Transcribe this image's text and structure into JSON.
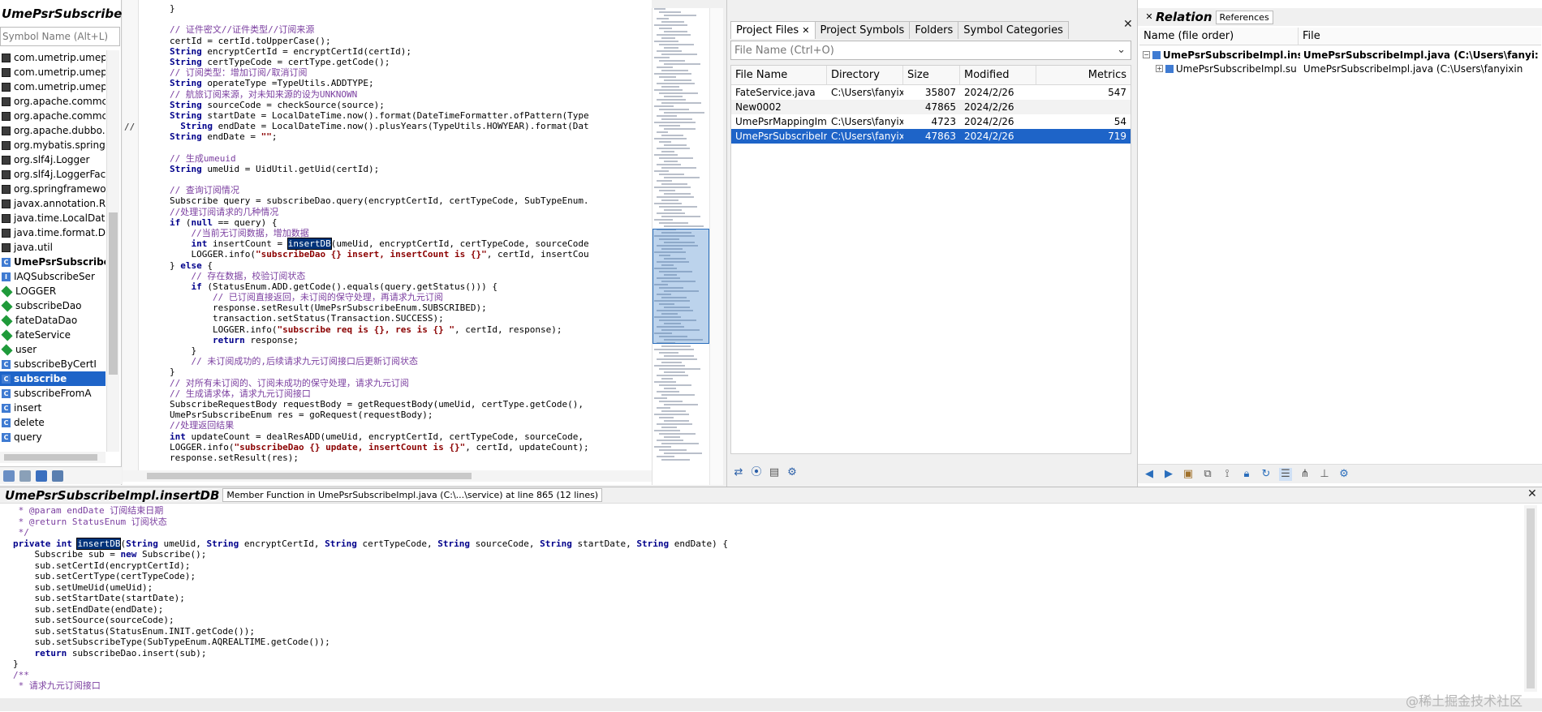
{
  "left_panel": {
    "title": "UmePsrSubscribeImpl",
    "search_placeholder": "Symbol Name (Alt+L)",
    "items": [
      {
        "label": "com.umetrip.umeps",
        "icon": "block-icon",
        "style": ""
      },
      {
        "label": "com.umetrip.umeps",
        "icon": "block-icon",
        "style": ""
      },
      {
        "label": "com.umetrip.umeps",
        "icon": "block-icon",
        "style": ""
      },
      {
        "label": "org.apache.commc",
        "icon": "block-icon",
        "style": ""
      },
      {
        "label": "org.apache.commc",
        "icon": "block-icon",
        "style": ""
      },
      {
        "label": "org.apache.dubbo.",
        "icon": "block-icon",
        "style": ""
      },
      {
        "label": "org.mybatis.spring.",
        "icon": "block-icon",
        "style": ""
      },
      {
        "label": "org.slf4j.Logger",
        "icon": "block-icon",
        "style": ""
      },
      {
        "label": "org.slf4j.LoggerFac",
        "icon": "block-icon",
        "style": ""
      },
      {
        "label": "org.springframewo",
        "icon": "block-icon",
        "style": ""
      },
      {
        "label": "javax.annotation.Re",
        "icon": "block-icon",
        "style": ""
      },
      {
        "label": "java.time.LocalDate",
        "icon": "block-icon",
        "style": ""
      },
      {
        "label": "java.time.format.Da",
        "icon": "block-icon",
        "style": ""
      },
      {
        "label": "java.util",
        "icon": "block-icon",
        "style": ""
      },
      {
        "label": "UmePsrSubscribeI",
        "icon": "class-icon",
        "style": "bold"
      },
      {
        "label": "IAQSubscribeSer",
        "icon": "interface-icon",
        "style": ""
      },
      {
        "label": "LOGGER",
        "icon": "field-icon",
        "style": ""
      },
      {
        "label": "subscribeDao",
        "icon": "field-icon",
        "style": ""
      },
      {
        "label": "fateDataDao",
        "icon": "field-icon",
        "style": ""
      },
      {
        "label": "fateService",
        "icon": "field-icon",
        "style": ""
      },
      {
        "label": "user",
        "icon": "field-icon",
        "style": ""
      },
      {
        "label": "subscribeByCertI",
        "icon": "method-icon",
        "style": ""
      },
      {
        "label": "subscribe",
        "icon": "method-icon",
        "style": "sel"
      },
      {
        "label": "subscribeFromA",
        "icon": "method-icon",
        "style": ""
      },
      {
        "label": "insert",
        "icon": "method-icon",
        "style": ""
      },
      {
        "label": "delete",
        "icon": "method-icon",
        "style": ""
      },
      {
        "label": "query",
        "icon": "method-icon",
        "style": ""
      }
    ]
  },
  "editor": {
    "gutter_marker": "//",
    "lines": [
      "}",
      "",
      "// 证件密文//证件类型//订阅来源",
      "certId = certId.toUpperCase();",
      "String encryptCertId = encryptCertId(certId);",
      "String certTypeCode = certType.getCode();",
      "// 订阅类型：增加订阅/取消订阅",
      "String operateType =TypeUtils.ADDTYPE;",
      "// 航旅订阅来源，对未知来源的设为UNKNOWN",
      "String sourceCode = checkSource(source);",
      "String startDate = LocalDateTime.now().format(DateTimeFormatter.ofPattern(Type",
      "  String endDate = LocalDateTime.now().plusYears(TypeUtils.HOWYEAR).format(Dat",
      "String endDate = \"\";",
      "",
      "// 生成umeuid",
      "String umeUid = UidUtil.getUid(certId);",
      "",
      "// 查询订阅情况",
      "Subscribe query = subscribeDao.query(encryptCertId, certTypeCode, SubTypeEnum.",
      "//处理订阅请求的几种情况",
      "if (null == query) {",
      "    //当前无订阅数据，增加数据",
      "    int insertCount = insertDB(umeUid, encryptCertId, certTypeCode, sourceCode",
      "    LOGGER.info(\"subscribeDao {} insert, insertCount is {}\", certId, insertCou",
      "} else {",
      "    // 存在数据，校验订阅状态",
      "    if (StatusEnum.ADD.getCode().equals(query.getStatus())) {",
      "        // 已订阅直接返回，未订阅的保守处理，再请求九元订阅",
      "        response.setResult(UmePsrSubscribeEnum.SUBSCRIBED);",
      "        transaction.setStatus(Transaction.SUCCESS);",
      "        LOGGER.info(\"subscribe req is {}, res is {} \", certId, response);",
      "        return response;",
      "    }",
      "    // 未订阅成功的,后续请求九元订阅接口后更新订阅状态",
      "}",
      "// 对所有未订阅的、订阅未成功的保守处理，请求九元订阅",
      "// 生成请求体，请求九元订阅接口",
      "SubscribeRequestBody requestBody = getRequestBody(umeUid, certType.getCode(),",
      "UmePsrSubscribeEnum res = goRequest(requestBody);",
      "//处理返回结果",
      "int updateCount = dealResADD(umeUid, encryptCertId, certTypeCode, sourceCode,",
      "LOGGER.info(\"subscribeDao {} update, insertCount is {}\", certId, updateCount);",
      "response.setResult(res);"
    ]
  },
  "project_panel": {
    "tabs": [
      "Project Files",
      "Project Symbols",
      "Folders",
      "Symbol Categories"
    ],
    "search_placeholder": "File Name (Ctrl+O)",
    "columns": [
      "File Name",
      "Directory",
      "Size",
      "Modified",
      "Metrics"
    ],
    "rows": [
      {
        "name": "FateService.java",
        "dir": "C:\\Users\\fanyix",
        "size": "35807",
        "modified": "2024/2/26",
        "metrics": "547",
        "selected": false
      },
      {
        "name": "New0002",
        "dir": "",
        "size": "47865",
        "modified": "2024/2/26",
        "metrics": "",
        "selected": false
      },
      {
        "name": "UmePsrMappingImp",
        "dir": "C:\\Users\\fanyix",
        "size": "4723",
        "modified": "2024/2/26",
        "metrics": "54",
        "selected": false
      },
      {
        "name": "UmePsrSubscribeIm",
        "dir": "C:\\Users\\fanyix",
        "size": "47863",
        "modified": "2024/2/26",
        "metrics": "719",
        "selected": true
      }
    ]
  },
  "relation_panel": {
    "title": "Relation",
    "tab": "References",
    "columns": [
      "Name (file order)",
      "File"
    ],
    "rows": [
      {
        "name": "UmePsrSubscribeImpl.inse",
        "file": "UmePsrSubscribeImpl.java (C:\\Users\\fanyi:",
        "bold": true,
        "indent": 0
      },
      {
        "name": "UmePsrSubscribeImpl.su",
        "file": "UmePsrSubscribeImpl.java (C:\\Users\\fanyixin",
        "bold": false,
        "indent": 1
      }
    ]
  },
  "bottom_panel": {
    "title": "UmePsrSubscribeImpl.insertDB",
    "description": "Member Function in UmePsrSubscribeImpl.java (C:\\...\\service) at line 865 (12 lines)",
    "lines": [
      " * @param endDate 订阅结束日期",
      " * @return StatusEnum 订阅状态",
      " */",
      "private int insertDB(String umeUid, String encryptCertId, String certTypeCode, String sourceCode, String startDate, String endDate) {",
      "    Subscribe sub = new Subscribe();",
      "    sub.setCertId(encryptCertId);",
      "    sub.setCertType(certTypeCode);",
      "    sub.setUmeUid(umeUid);",
      "    sub.setStartDate(startDate);",
      "    sub.setEndDate(endDate);",
      "    sub.setSource(sourceCode);",
      "    sub.setStatus(StatusEnum.INIT.getCode());",
      "    sub.setSubscribeType(SubTypeEnum.AQREALTIME.getCode());",
      "    return subscribeDao.insert(sub);",
      "}",
      "/**",
      " * 请求九元订阅接口"
    ],
    "watermark": "@稀土掘金技术社区"
  },
  "colors": {
    "selection": "#1e64c8",
    "comment": "#7b3fa0",
    "keyword": "#00008b",
    "string": "#8b0000"
  }
}
